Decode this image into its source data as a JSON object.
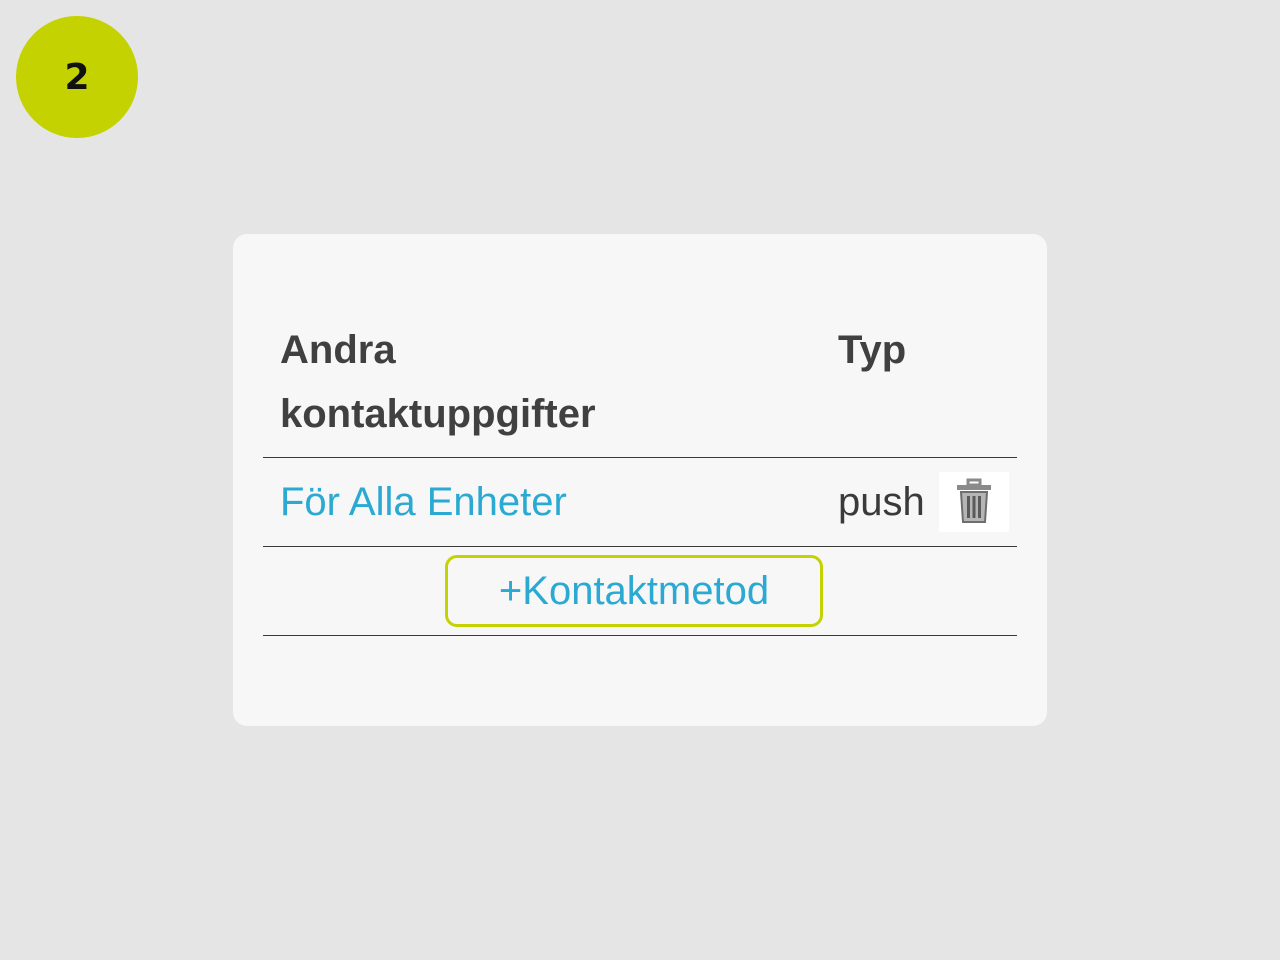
{
  "step": {
    "number": "2",
    "color": "#c3d200"
  },
  "table": {
    "headers": {
      "contact": "Andra kontaktuppgifter",
      "type": "Typ"
    },
    "rows": [
      {
        "name": "För Alla Enheter",
        "type": "push",
        "delete_icon": "trash-icon"
      }
    ],
    "add_button_label": "+Kontaktmetod"
  },
  "colors": {
    "link": "#2aa9d2",
    "highlight": "#c3d200",
    "text": "#404040",
    "card": "#f7f7f7",
    "background": "#e5e5e5"
  }
}
